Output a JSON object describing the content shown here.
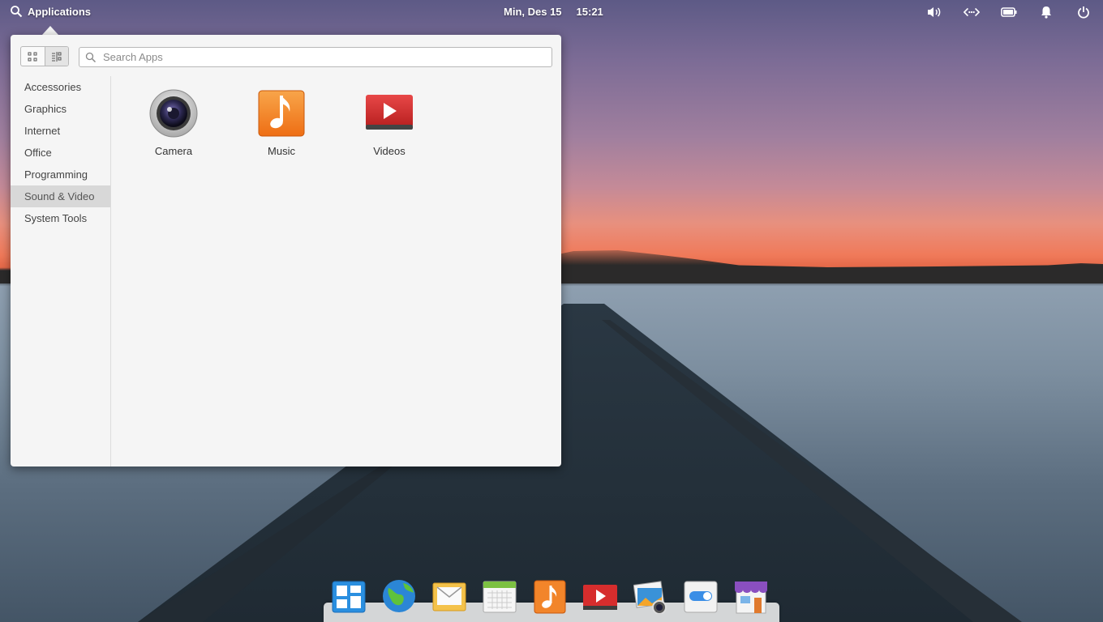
{
  "panel": {
    "applications_label": "Applications",
    "date": "Min, Des 15",
    "time": "15:21",
    "indicators": [
      "volume-icon",
      "network-icon",
      "battery-icon",
      "notification-bell-icon",
      "power-icon"
    ]
  },
  "menu": {
    "search_placeholder": "Search Apps",
    "view_modes": [
      "grid-view-icon",
      "category-view-icon"
    ],
    "categories": [
      {
        "label": "Accessories"
      },
      {
        "label": "Graphics"
      },
      {
        "label": "Internet"
      },
      {
        "label": "Office"
      },
      {
        "label": "Programming"
      },
      {
        "label": "Sound & Video",
        "active": true
      },
      {
        "label": "System Tools"
      }
    ],
    "apps": [
      {
        "label": "Camera",
        "icon": "camera-icon"
      },
      {
        "label": "Music",
        "icon": "music-icon"
      },
      {
        "label": "Videos",
        "icon": "videos-icon"
      }
    ]
  },
  "dock": {
    "items": [
      "multitasking-view-icon",
      "web-browser-icon",
      "mail-icon",
      "calendar-icon",
      "music-icon",
      "videos-icon",
      "photos-icon",
      "settings-icon",
      "appcenter-icon"
    ]
  },
  "colors": {
    "menu_bg": "#f5f5f5",
    "active_category_bg": "#d8d8d8",
    "music_orange": "#f37a1f",
    "video_red": "#d62d2d"
  }
}
